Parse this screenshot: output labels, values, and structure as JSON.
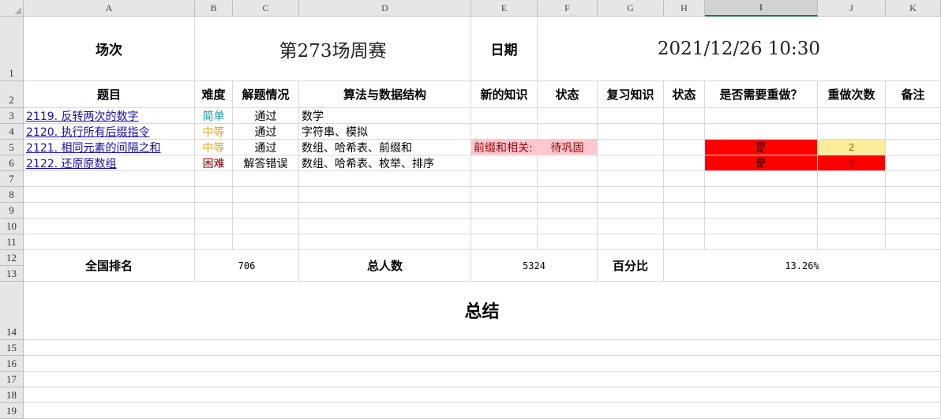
{
  "colors": {
    "easy": "#1a9aa0",
    "medium": "#e6a817",
    "hard": "#8b0000",
    "pink": "#ffc7ce",
    "pink_text": "#9c0006",
    "red": "#ff0000",
    "yellow": "#ffeb9c",
    "yellow_text": "#9c6500",
    "link": "#1a0dab"
  },
  "columns": [
    "A",
    "B",
    "C",
    "D",
    "E",
    "F",
    "G",
    "H",
    "I",
    "J",
    "K"
  ],
  "rows": [
    "1",
    "2",
    "3",
    "4",
    "5",
    "6",
    "7",
    "8",
    "9",
    "10",
    "11",
    "12",
    "13",
    "14",
    "15",
    "16",
    "17",
    "18",
    "19"
  ],
  "header": {
    "session_label": "场次",
    "session_value": "第273场周赛",
    "date_label": "日期",
    "date_value": "2021/12/26  10:30"
  },
  "table_headers": [
    "题目",
    "难度",
    "解题情况",
    "算法与数据结构",
    "新的知识",
    "状态",
    "复习知识",
    "状态",
    "是否需要重做？",
    "重做次数",
    "备注"
  ],
  "problems": [
    {
      "title": "2119. 反转两次的数字",
      "difficulty": "简单",
      "result": "通过",
      "algo": "数学",
      "new_knowledge": "",
      "status": "",
      "review": "",
      "review_status": "",
      "redo": "",
      "redo_count": "",
      "note": ""
    },
    {
      "title": "2120. 执行所有后缀指令",
      "difficulty": "中等",
      "result": "通过",
      "algo": "字符串、模拟",
      "new_knowledge": "",
      "status": "",
      "review": "",
      "review_status": "",
      "redo": "",
      "redo_count": "",
      "note": ""
    },
    {
      "title": "2121. 相同元素的间隔之和",
      "difficulty": "中等",
      "result": "通过",
      "algo": "数组、哈希表、前缀和",
      "new_knowledge": "前缀和相关:",
      "status": "待巩固",
      "review": "",
      "review_status": "",
      "redo": "是",
      "redo_count": "2",
      "note": ""
    },
    {
      "title": "2122. 还原原数组",
      "difficulty": "困难",
      "result": "解答错误",
      "algo": "数组、哈希表、枚举、排序",
      "new_knowledge": "",
      "status": "",
      "review": "",
      "review_status": "",
      "redo": "是",
      "redo_count": "0",
      "note": ""
    }
  ],
  "stats": {
    "rank_label": "全国排名",
    "rank_value": "706",
    "total_label": "总人数",
    "total_value": "5324",
    "pct_label": "百分比",
    "pct_value": "13.26%"
  },
  "summary": {
    "label": "总结"
  }
}
